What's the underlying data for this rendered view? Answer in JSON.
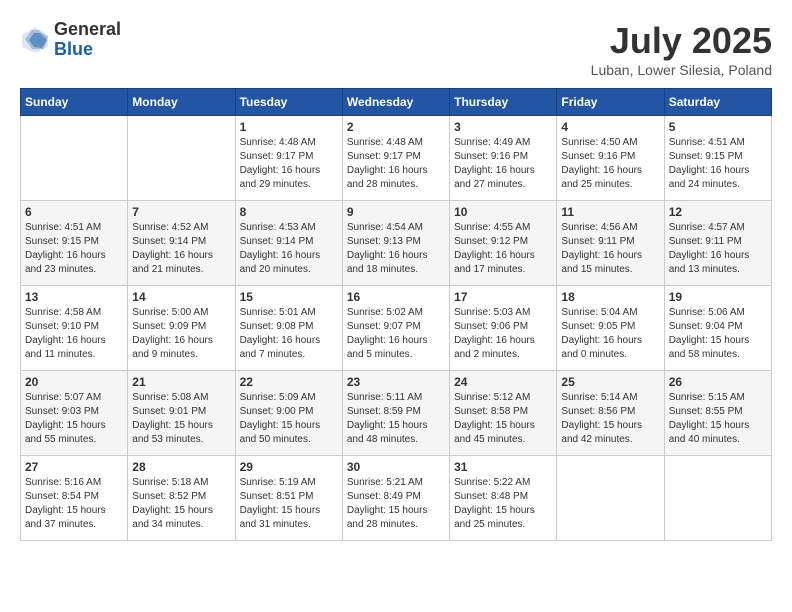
{
  "logo": {
    "general": "General",
    "blue": "Blue"
  },
  "title": "July 2025",
  "location": "Luban, Lower Silesia, Poland",
  "days_of_week": [
    "Sunday",
    "Monday",
    "Tuesday",
    "Wednesday",
    "Thursday",
    "Friday",
    "Saturday"
  ],
  "weeks": [
    [
      {
        "day": "",
        "info": ""
      },
      {
        "day": "",
        "info": ""
      },
      {
        "day": "1",
        "info": "Sunrise: 4:48 AM\nSunset: 9:17 PM\nDaylight: 16 hours\nand 29 minutes."
      },
      {
        "day": "2",
        "info": "Sunrise: 4:48 AM\nSunset: 9:17 PM\nDaylight: 16 hours\nand 28 minutes."
      },
      {
        "day": "3",
        "info": "Sunrise: 4:49 AM\nSunset: 9:16 PM\nDaylight: 16 hours\nand 27 minutes."
      },
      {
        "day": "4",
        "info": "Sunrise: 4:50 AM\nSunset: 9:16 PM\nDaylight: 16 hours\nand 25 minutes."
      },
      {
        "day": "5",
        "info": "Sunrise: 4:51 AM\nSunset: 9:15 PM\nDaylight: 16 hours\nand 24 minutes."
      }
    ],
    [
      {
        "day": "6",
        "info": "Sunrise: 4:51 AM\nSunset: 9:15 PM\nDaylight: 16 hours\nand 23 minutes."
      },
      {
        "day": "7",
        "info": "Sunrise: 4:52 AM\nSunset: 9:14 PM\nDaylight: 16 hours\nand 21 minutes."
      },
      {
        "day": "8",
        "info": "Sunrise: 4:53 AM\nSunset: 9:14 PM\nDaylight: 16 hours\nand 20 minutes."
      },
      {
        "day": "9",
        "info": "Sunrise: 4:54 AM\nSunset: 9:13 PM\nDaylight: 16 hours\nand 18 minutes."
      },
      {
        "day": "10",
        "info": "Sunrise: 4:55 AM\nSunset: 9:12 PM\nDaylight: 16 hours\nand 17 minutes."
      },
      {
        "day": "11",
        "info": "Sunrise: 4:56 AM\nSunset: 9:11 PM\nDaylight: 16 hours\nand 15 minutes."
      },
      {
        "day": "12",
        "info": "Sunrise: 4:57 AM\nSunset: 9:11 PM\nDaylight: 16 hours\nand 13 minutes."
      }
    ],
    [
      {
        "day": "13",
        "info": "Sunrise: 4:58 AM\nSunset: 9:10 PM\nDaylight: 16 hours\nand 11 minutes."
      },
      {
        "day": "14",
        "info": "Sunrise: 5:00 AM\nSunset: 9:09 PM\nDaylight: 16 hours\nand 9 minutes."
      },
      {
        "day": "15",
        "info": "Sunrise: 5:01 AM\nSunset: 9:08 PM\nDaylight: 16 hours\nand 7 minutes."
      },
      {
        "day": "16",
        "info": "Sunrise: 5:02 AM\nSunset: 9:07 PM\nDaylight: 16 hours\nand 5 minutes."
      },
      {
        "day": "17",
        "info": "Sunrise: 5:03 AM\nSunset: 9:06 PM\nDaylight: 16 hours\nand 2 minutes."
      },
      {
        "day": "18",
        "info": "Sunrise: 5:04 AM\nSunset: 9:05 PM\nDaylight: 16 hours\nand 0 minutes."
      },
      {
        "day": "19",
        "info": "Sunrise: 5:06 AM\nSunset: 9:04 PM\nDaylight: 15 hours\nand 58 minutes."
      }
    ],
    [
      {
        "day": "20",
        "info": "Sunrise: 5:07 AM\nSunset: 9:03 PM\nDaylight: 15 hours\nand 55 minutes."
      },
      {
        "day": "21",
        "info": "Sunrise: 5:08 AM\nSunset: 9:01 PM\nDaylight: 15 hours\nand 53 minutes."
      },
      {
        "day": "22",
        "info": "Sunrise: 5:09 AM\nSunset: 9:00 PM\nDaylight: 15 hours\nand 50 minutes."
      },
      {
        "day": "23",
        "info": "Sunrise: 5:11 AM\nSunset: 8:59 PM\nDaylight: 15 hours\nand 48 minutes."
      },
      {
        "day": "24",
        "info": "Sunrise: 5:12 AM\nSunset: 8:58 PM\nDaylight: 15 hours\nand 45 minutes."
      },
      {
        "day": "25",
        "info": "Sunrise: 5:14 AM\nSunset: 8:56 PM\nDaylight: 15 hours\nand 42 minutes."
      },
      {
        "day": "26",
        "info": "Sunrise: 5:15 AM\nSunset: 8:55 PM\nDaylight: 15 hours\nand 40 minutes."
      }
    ],
    [
      {
        "day": "27",
        "info": "Sunrise: 5:16 AM\nSunset: 8:54 PM\nDaylight: 15 hours\nand 37 minutes."
      },
      {
        "day": "28",
        "info": "Sunrise: 5:18 AM\nSunset: 8:52 PM\nDaylight: 15 hours\nand 34 minutes."
      },
      {
        "day": "29",
        "info": "Sunrise: 5:19 AM\nSunset: 8:51 PM\nDaylight: 15 hours\nand 31 minutes."
      },
      {
        "day": "30",
        "info": "Sunrise: 5:21 AM\nSunset: 8:49 PM\nDaylight: 15 hours\nand 28 minutes."
      },
      {
        "day": "31",
        "info": "Sunrise: 5:22 AM\nSunset: 8:48 PM\nDaylight: 15 hours\nand 25 minutes."
      },
      {
        "day": "",
        "info": ""
      },
      {
        "day": "",
        "info": ""
      }
    ]
  ]
}
